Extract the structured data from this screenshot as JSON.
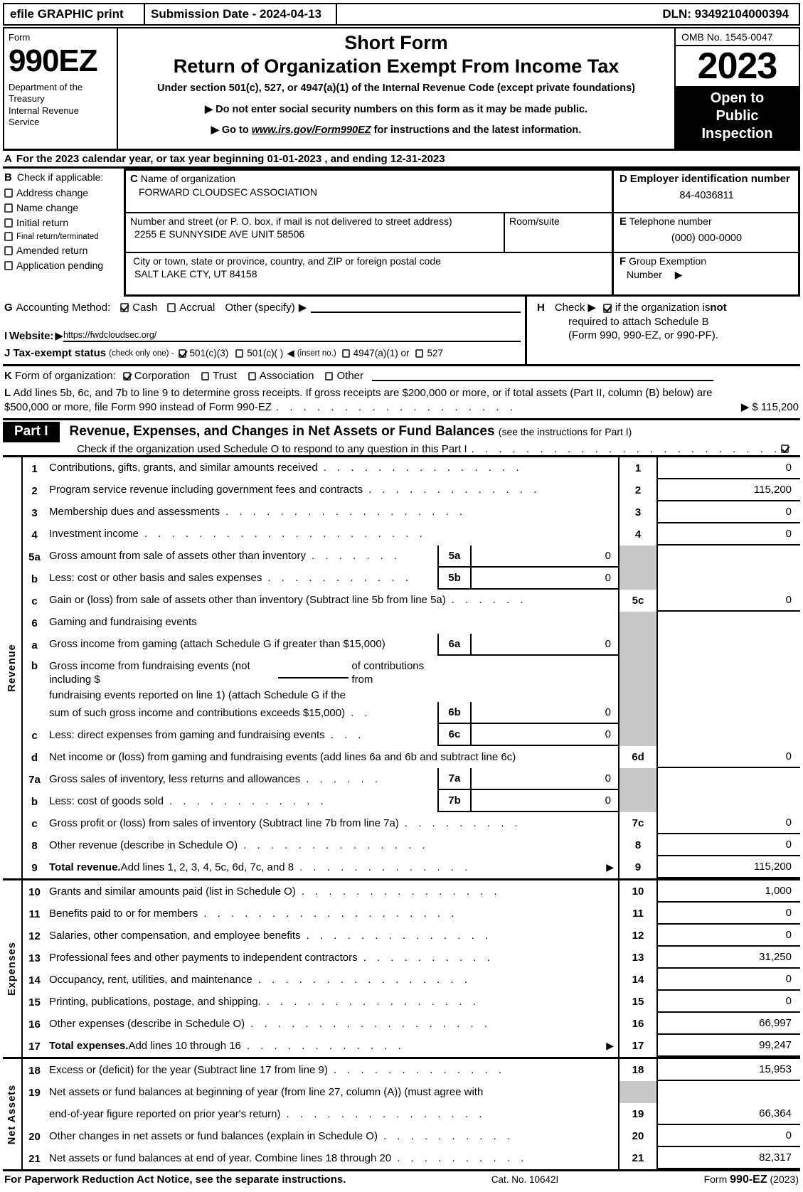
{
  "efile": {
    "graphic_label": "efile GRAPHIC print",
    "submission_label": "Submission Date - 2024-04-13",
    "dln_label": "DLN: 93492104000394"
  },
  "masthead": {
    "form_word": "Form",
    "form_number": "990EZ",
    "dept_line1": "Department of the",
    "dept_line2": "Treasury",
    "dept_line3": "Internal Revenue",
    "dept_line4": "Service",
    "title1": "Short Form",
    "title2": "Return of Organization Exempt From Income Tax",
    "subtitle": "Under section 501(c), 527, or 4947(a)(1) of the Internal Revenue Code (except private foundations)",
    "bullet1": "Do not enter social security numbers on this form as it may be made public.",
    "bullet2_pre": "Go to ",
    "bullet2_link": "www.irs.gov/Form990EZ",
    "bullet2_post": " for instructions and the latest information.",
    "omb": "OMB No. 1545-0047",
    "year": "2023",
    "open_to": "Open to",
    "public": "Public",
    "inspection": "Inspection"
  },
  "line_a": {
    "letter": "A",
    "text": "For the 2023 calendar year, or tax year beginning 01-01-2023 , and ending 12-31-2023"
  },
  "section_b": {
    "letter": "B",
    "heading": "Check if applicable:",
    "items": [
      {
        "label": "Address change",
        "checked": false,
        "small": false
      },
      {
        "label": "Name change",
        "checked": false,
        "small": false
      },
      {
        "label": "Initial return",
        "checked": false,
        "small": false
      },
      {
        "label": "Final return/terminated",
        "checked": false,
        "small": true
      },
      {
        "label": "Amended return",
        "checked": false,
        "small": false
      },
      {
        "label": "Application pending",
        "checked": false,
        "small": false
      }
    ]
  },
  "section_c": {
    "letter": "C",
    "name_label": "Name of organization",
    "org_name": "FORWARD CLOUDSEC ASSOCIATION",
    "street_label": "Number and street (or P. O. box, if mail is not delivered to street address)",
    "street_value": "2255 E SUNNYSIDE AVE UNIT 58506",
    "room_label": "Room/suite",
    "room_value": "",
    "city_label": "City or town, state or province, country, and ZIP or foreign postal code",
    "city_value": "SALT LAKE CTY, UT  84158"
  },
  "section_d": {
    "letter": "D",
    "label": "Employer identification number",
    "value": "84-4036811"
  },
  "section_e": {
    "letter": "E",
    "label": "Telephone number",
    "value": "(000) 000-0000"
  },
  "section_f": {
    "letter": "F",
    "label": "Group Exemption",
    "label2": "Number",
    "arrow": "▶",
    "value": ""
  },
  "section_g": {
    "letter": "G",
    "label": "Accounting Method:",
    "cash_label": "Cash",
    "cash_checked": true,
    "accrual_label": "Accrual",
    "accrual_checked": false,
    "other_label": "Other (specify)",
    "other_arrow": "▶",
    "other_value": ""
  },
  "section_h": {
    "letter": "H",
    "check_word": "Check",
    "arrow": "▶",
    "checked": true,
    "line1_a": "if the organization is ",
    "line1_b": "not",
    "line2": "required to attach Schedule B",
    "line3": "(Form 990, 990-EZ, or 990-PF)."
  },
  "section_i": {
    "letter": "I",
    "label": "Website:",
    "arrow": "▶",
    "value": "https://fwdcloudsec.org/"
  },
  "section_j": {
    "letter": "J",
    "label": "Tax-exempt status",
    "note": "(check only one) -",
    "opt1": "501(c)(3)",
    "opt1_checked": true,
    "opt2": "501(c)(   )",
    "opt2_checked": false,
    "insert": "(insert no.)",
    "insert_arrow": "◀",
    "opt3": "4947(a)(1) or",
    "opt3_checked": false,
    "opt4": "527",
    "opt4_checked": false
  },
  "section_k": {
    "letter": "K",
    "label": "Form of organization:",
    "opts": [
      {
        "label": "Corporation",
        "checked": true
      },
      {
        "label": "Trust",
        "checked": false
      },
      {
        "label": "Association",
        "checked": false
      },
      {
        "label": "Other",
        "checked": false
      }
    ]
  },
  "section_l": {
    "letter": "L",
    "text1": "Add lines 5b, 6c, and 7b to line 9 to determine gross receipts. If gross receipts are $200,000 or more, or if total assets (Part II, column (B) below) are",
    "text2": "$500,000 or more, file Form 990 instead of Form 990-EZ",
    "arrow": "▶",
    "amount": "$ 115,200"
  },
  "part1": {
    "label": "Part I",
    "title": "Revenue, Expenses, and Changes in Net Assets or Fund Balances",
    "subtitle": "(see the instructions for Part I)",
    "schedule_o_text": "Check if the organization used Schedule O to respond to any question in this Part I",
    "schedule_o_checked": true
  },
  "revenue": {
    "vlabel": "Revenue",
    "rows": [
      {
        "num": "1",
        "desc": "Contributions, gifts, grants, and similar amounts received",
        "main_num": "1",
        "main_val": "0"
      },
      {
        "num": "2",
        "desc": "Program service revenue including government fees and contracts",
        "main_num": "2",
        "main_val": "115,200"
      },
      {
        "num": "3",
        "desc": "Membership dues and assessments",
        "main_num": "3",
        "main_val": "0"
      },
      {
        "num": "4",
        "desc": "Investment income",
        "main_num": "4",
        "main_val": "0"
      },
      {
        "num": "5a",
        "desc": "Gross amount from sale of assets other than inventory",
        "sub_num": "5a",
        "sub_val": "0",
        "main_num": "",
        "main_val": "",
        "gray": true
      },
      {
        "num": "b",
        "desc": "Less: cost or other basis and sales expenses",
        "sub_num": "5b",
        "sub_val": "0",
        "main_num": "",
        "main_val": "",
        "gray": true
      },
      {
        "num": "c",
        "desc": "Gain or (loss) from sale of assets other than inventory (Subtract line 5b from line 5a)",
        "main_num": "5c",
        "main_val": "0"
      },
      {
        "num": "6",
        "desc": "Gaming and fundraising events",
        "main_num": "",
        "main_val": "",
        "gray": true
      },
      {
        "num": "a",
        "desc": "Gross income from gaming (attach Schedule G if greater than $15,000)",
        "sub_num": "6a",
        "sub_val": "0",
        "main_num": "",
        "main_val": "",
        "gray": true
      },
      {
        "num": "b",
        "desc_l1a": "Gross income from fundraising events (not including $",
        "desc_l1b": "of contributions from",
        "desc_l2": "fundraising events reported on line 1) (attach Schedule G if the",
        "desc_l3": "sum of such gross income and contributions exceeds $15,000)",
        "sub_num": "6b",
        "sub_val": "0",
        "main_num": "",
        "main_val": "",
        "gray": true
      },
      {
        "num": "c",
        "desc": "Less: direct expenses from gaming and fundraising events",
        "sub_num": "6c",
        "sub_val": "0",
        "main_num": "",
        "main_val": "",
        "gray": true
      },
      {
        "num": "d",
        "desc": "Net income or (loss) from gaming and fundraising events (add lines 6a and 6b and subtract line 6c)",
        "main_num": "6d",
        "main_val": "0"
      },
      {
        "num": "7a",
        "desc": "Gross sales of inventory, less returns and allowances",
        "sub_num": "7a",
        "sub_val": "0",
        "main_num": "",
        "main_val": "",
        "gray": true
      },
      {
        "num": "b",
        "desc": "Less: cost of goods sold",
        "sub_num": "7b",
        "sub_val": "0",
        "main_num": "",
        "main_val": "",
        "gray": true
      },
      {
        "num": "c",
        "desc": "Gross profit or (loss) from sales of inventory (Subtract line 7b from line 7a)",
        "main_num": "7c",
        "main_val": "0"
      },
      {
        "num": "8",
        "desc": "Other revenue (describe in Schedule O)",
        "main_num": "8",
        "main_val": "0"
      },
      {
        "num": "9",
        "desc_bold": "Total revenue.",
        "desc": " Add lines 1, 2, 3, 4, 5c, 6d, 7c, and 8",
        "main_num": "9",
        "main_val": "115,200",
        "arrow": true
      }
    ]
  },
  "expenses": {
    "vlabel": "Expenses",
    "rows": [
      {
        "num": "10",
        "desc": "Grants and similar amounts paid (list in Schedule O)",
        "main_num": "10",
        "main_val": "1,000"
      },
      {
        "num": "11",
        "desc": "Benefits paid to or for members",
        "main_num": "11",
        "main_val": "0"
      },
      {
        "num": "12",
        "desc": "Salaries, other compensation, and employee benefits",
        "main_num": "12",
        "main_val": "0"
      },
      {
        "num": "13",
        "desc": "Professional fees and other payments to independent contractors",
        "main_num": "13",
        "main_val": "31,250"
      },
      {
        "num": "14",
        "desc": "Occupancy, rent, utilities, and maintenance",
        "main_num": "14",
        "main_val": "0"
      },
      {
        "num": "15",
        "desc": "Printing, publications, postage, and shipping.",
        "main_num": "15",
        "main_val": "0"
      },
      {
        "num": "16",
        "desc": "Other expenses (describe in Schedule O)",
        "main_num": "16",
        "main_val": "66,997"
      },
      {
        "num": "17",
        "desc_bold": "Total expenses.",
        "desc": " Add lines 10 through 16",
        "main_num": "17",
        "main_val": "99,247",
        "arrow": true
      }
    ]
  },
  "netassets": {
    "vlabel": "Net Assets",
    "rows": [
      {
        "num": "18",
        "desc": "Excess or (deficit) for the year (Subtract line 17 from line 9)",
        "main_num": "18",
        "main_val": "15,953"
      },
      {
        "num": "19",
        "desc": "Net assets or fund balances at beginning of year (from line 27, column (A)) (must agree with",
        "main_num": "",
        "main_val": "",
        "gray": true,
        "nodots": true
      },
      {
        "num": "",
        "desc": "end-of-year figure reported on prior year's return)",
        "main_num": "19",
        "main_val": "66,364"
      },
      {
        "num": "20",
        "desc": "Other changes in net assets or fund balances (explain in Schedule O)",
        "main_num": "20",
        "main_val": "0"
      },
      {
        "num": "21",
        "desc": "Net assets or fund balances at end of year. Combine lines 18 through 20",
        "main_num": "21",
        "main_val": "82,317"
      }
    ]
  },
  "footer": {
    "notice": "For Paperwork Reduction Act Notice, see the separate instructions.",
    "cat": "Cat. No. 10642I",
    "form_pre": "Form ",
    "form_no": "990-EZ",
    "form_year": " (2023)"
  }
}
